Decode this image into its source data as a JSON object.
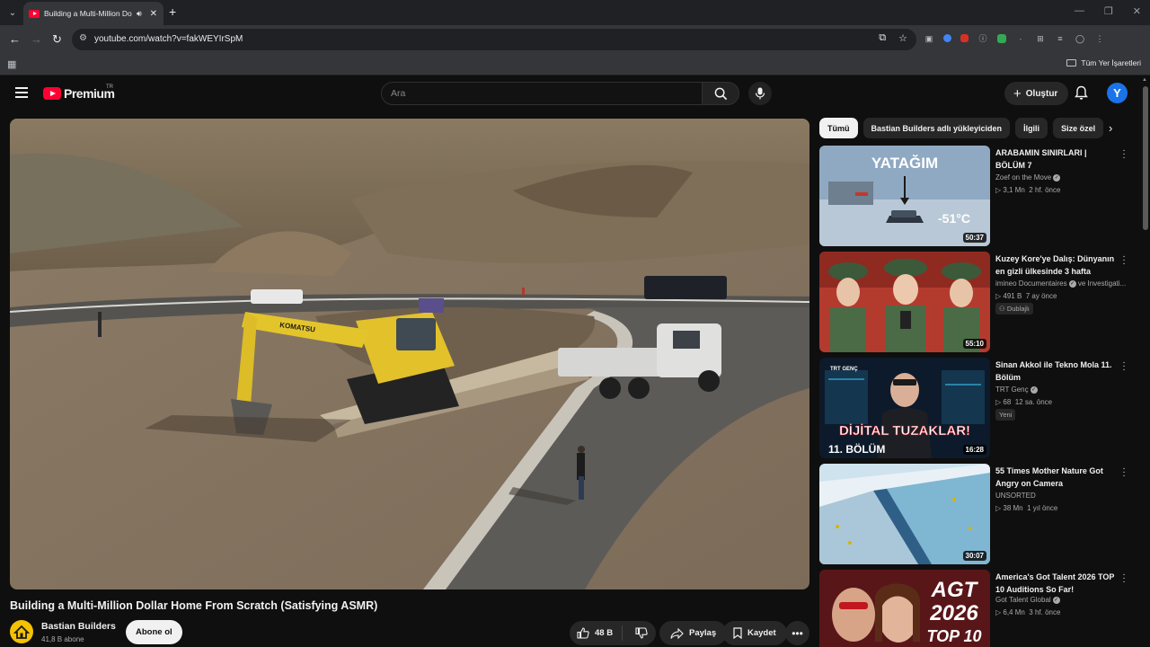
{
  "browser": {
    "tab_title": "Building a Multi-Million Dollar Home From Scratch (Satisfying ASMR) - YouTube",
    "url": "youtube.com/watch?v=fakWEYIrSpM",
    "bookmark_folder": "Tüm Yer İşaretleri"
  },
  "masthead": {
    "logo_text": "Premium",
    "country_code": "TR",
    "search_placeholder": "Ara",
    "create_label": "Oluştur",
    "avatar_letter": "Y"
  },
  "video": {
    "title": "Building a Multi-Million Dollar Home From Scratch (Satisfying ASMR)",
    "channel_name": "Bastian Builders",
    "subscribers": "41,8 B abone",
    "subscribe_label": "Abone ol",
    "likes": "48 B",
    "share_label": "Paylaş",
    "save_label": "Kaydet",
    "excavator_brand": "KOMATSU"
  },
  "chips": [
    "Tümü",
    "Bastian Builders adlı yükleyiciden",
    "İlgili",
    "Size özel"
  ],
  "recommendations": [
    {
      "title": "ARABAMIN SINIRLARI | BÖLÜM 7",
      "channel": "Zoef on the Move",
      "views": "3,1 Mn",
      "age": "2 hf. önce",
      "duration": "50:37",
      "thumb_text_top": "YATAĞIM",
      "thumb_text_temp": "-51°C"
    },
    {
      "title": "Kuzey Kore'ye Dalış: Dünyanın en gizli ülkesinde 3 hafta",
      "channel": "imineo Documentaires",
      "channel_extra": "ve Investigati...",
      "views": "491 B",
      "age": "7 ay önce",
      "badge": "Dublajlı",
      "duration": "55:10"
    },
    {
      "title": "Sinan Akkol ile Tekno Mola 11. Bölüm",
      "channel": "TRT Genç",
      "views": "68",
      "age": "12 sa. önce",
      "badge": "Yeni",
      "duration": "16:28",
      "thumb_text_brand": "TRT GENÇ",
      "thumb_text_main": "DİJİTAL TUZAKLAR!",
      "thumb_text_episode": "11. BÖLÜM"
    },
    {
      "title": "55 Times Mother Nature Got Angry on Camera",
      "channel": "UNSORTED",
      "views": "38 Mn",
      "age": "1 yıl önce",
      "duration": "30:07"
    },
    {
      "title": "America's Got Talent 2026 TOP 10 Auditions So Far!",
      "channel": "Got Talent Global",
      "views": "6,4 Mn",
      "age": "3 hf. önce",
      "thumb_text_a": "AGT",
      "thumb_text_b": "2026",
      "thumb_text_c": "TOP 10"
    }
  ]
}
